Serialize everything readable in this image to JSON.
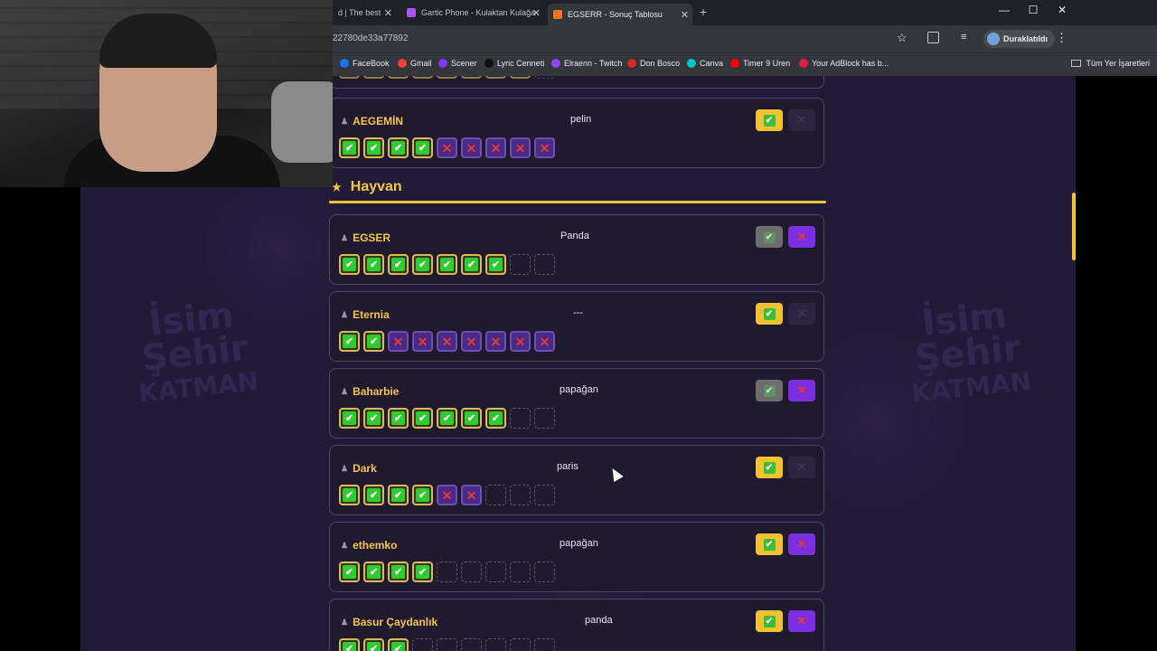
{
  "browser": {
    "tabs": [
      {
        "label": "d | The best ",
        "icon_color": "#5b6b9a"
      },
      {
        "label": "Gartic Phone - Kulaktan Kulağa",
        "icon_color": "#a855f7"
      },
      {
        "label": "EGSERR - Sonuç Tablosu",
        "icon_color": "#f97316",
        "active": true
      }
    ],
    "new_tab": "+",
    "window_controls": {
      "minimize": "—",
      "maximize": "☐",
      "close": "✕"
    },
    "url": "22780de33a77892",
    "profile_status": "Duraklatıldı",
    "bookmarks": [
      {
        "label": "FaceBook",
        "icon_color": "#1877f2"
      },
      {
        "label": "Gmail",
        "icon_color": "#ea4335"
      },
      {
        "label": "Scener",
        "icon_color": "#7c3aed"
      },
      {
        "label": "Lyric Cenneti",
        "icon_color": "#111111"
      },
      {
        "label": "Elraenn - Twitch",
        "icon_color": "#9146ff"
      },
      {
        "label": "Don Bosco",
        "icon_color": "#dc2626"
      },
      {
        "label": "Canva",
        "icon_color": "#00c4cc"
      },
      {
        "label": "Timer 9 Uren",
        "icon_color": "#ff0000"
      },
      {
        "label": "Your AdBlock has b...",
        "icon_color": "#e11d48"
      }
    ],
    "bookmarks_folder": "Tüm Yer İşaretleri"
  },
  "watermark": {
    "line1": "İsim",
    "line2": "Şehir",
    "line3": "KATMAN"
  },
  "top_card": {
    "player": "AEGEMİN",
    "answer": "pelin",
    "yes_active": true,
    "no_active": false,
    "boxes": [
      "ok",
      "ok",
      "ok",
      "ok",
      "bad",
      "bad",
      "bad",
      "bad",
      "bad"
    ]
  },
  "section": {
    "title": "Hayvan",
    "icon": "★"
  },
  "cards": [
    {
      "player": "EGSER",
      "answer": "Panda",
      "yes_active": false,
      "no_active": true,
      "boxes": [
        "ok",
        "ok",
        "ok",
        "ok",
        "ok",
        "ok",
        "ok",
        "empty",
        "empty"
      ]
    },
    {
      "player": "Eternia",
      "answer": "---",
      "yes_active": true,
      "no_active": false,
      "boxes": [
        "ok",
        "ok",
        "bad",
        "bad",
        "bad",
        "bad",
        "bad",
        "bad",
        "bad"
      ]
    },
    {
      "player": "Baharbie",
      "answer": "papağan",
      "yes_active": false,
      "no_active": true,
      "boxes": [
        "ok",
        "ok",
        "ok",
        "ok",
        "ok",
        "ok",
        "ok",
        "empty",
        "empty"
      ]
    },
    {
      "player": "Dark",
      "answer": "paris",
      "yes_active": true,
      "no_active": false,
      "boxes": [
        "ok",
        "ok",
        "ok",
        "ok",
        "bad",
        "bad",
        "empty",
        "empty",
        "empty"
      ]
    },
    {
      "player": "ethemko",
      "answer": "papağan",
      "yes_active": true,
      "no_active": true,
      "boxes": [
        "ok",
        "ok",
        "ok",
        "ok",
        "empty",
        "empty",
        "empty",
        "empty",
        "empty"
      ]
    },
    {
      "player": "Basur Çaydanlık",
      "answer": "panda",
      "yes_active": true,
      "no_active": true,
      "boxes": [
        "ok",
        "ok",
        "ok",
        "empty",
        "empty",
        "empty",
        "empty",
        "empty",
        "empty"
      ]
    }
  ],
  "icons": {
    "check": "✔",
    "cross": "✕",
    "user": "👤"
  }
}
